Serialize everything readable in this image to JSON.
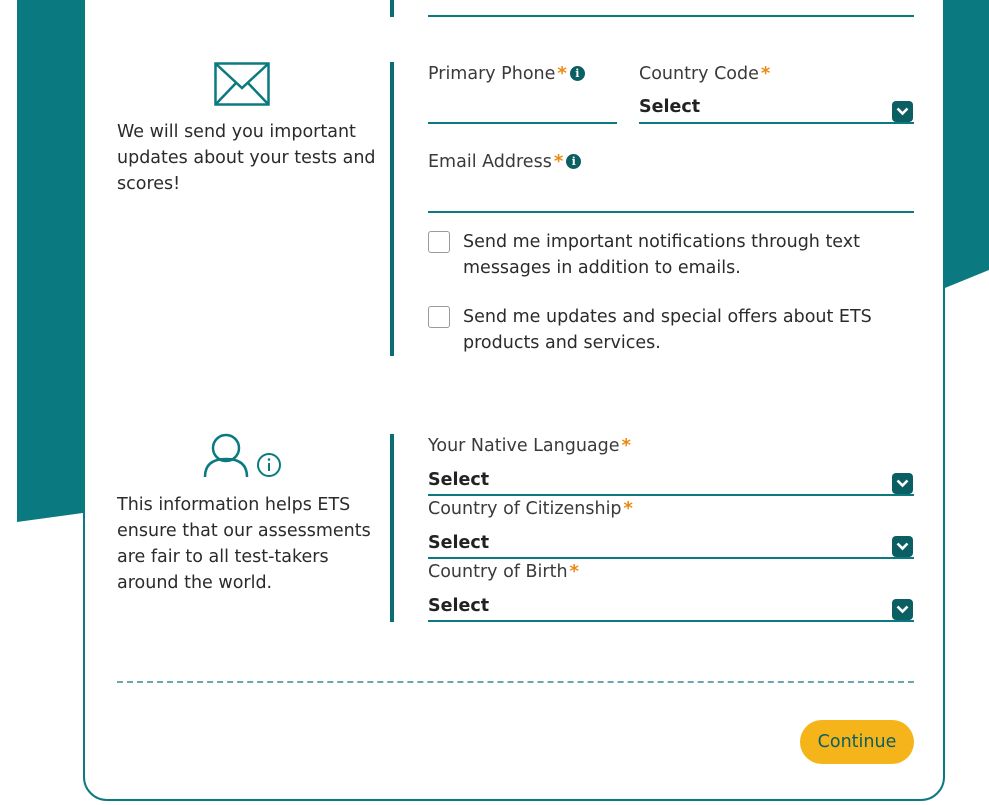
{
  "colors": {
    "teal": "#0b7a80",
    "teal_dark": "#0b5f63",
    "required_star": "#e98a14",
    "button_bg": "#f5b41a"
  },
  "contact_section": {
    "icon": "envelope-icon",
    "description": "We will send you important updates about your tests and scores!",
    "primary_phone": {
      "label": "Primary Phone",
      "required_mark": "*",
      "info_icon": "i",
      "value": ""
    },
    "country_code": {
      "label": "Country Code",
      "required_mark": "*",
      "selected": "Select"
    },
    "email": {
      "label": "Email Address",
      "required_mark": "*",
      "info_icon": "i",
      "value": ""
    },
    "checkboxes": [
      {
        "label": "Send me important notifications through text messages in addition to emails.",
        "checked": false
      },
      {
        "label": "Send me updates and special offers about ETS products and services.",
        "checked": false
      }
    ]
  },
  "background_section": {
    "icon": "user-info-icon",
    "description": "This information helps ETS ensure that our assessments are fair to all test-takers around the world.",
    "native_language": {
      "label": "Your Native Language",
      "required_mark": "*",
      "selected": "Select"
    },
    "citizenship": {
      "label": "Country of Citizenship",
      "required_mark": "*",
      "selected": "Select"
    },
    "birth_country": {
      "label": "Country of Birth",
      "required_mark": "*",
      "selected": "Select"
    }
  },
  "footer": {
    "continue_label": "Continue"
  }
}
